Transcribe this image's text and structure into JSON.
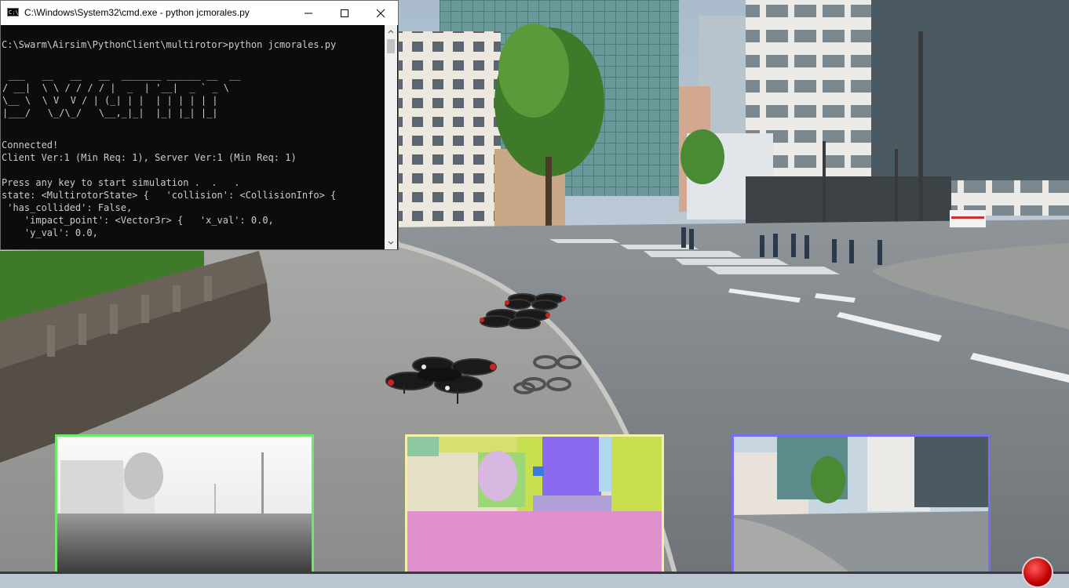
{
  "cmd_window": {
    "title": "C:\\Windows\\System32\\cmd.exe - python  jcmorales.py",
    "icon_label": "C:\\",
    "prompt": "C:\\Swarm\\Airsim\\PythonClient\\multirotor>python jcmorales.py",
    "banner": [
      " ___   __   __   __  _______ ______ __  __ ",
      "/ __|  \\ \\ / / / / |  _  | '__|  _ ` _ \\",
      "\\__ \\  \\ V  V / | (_| | |  | | | | | |",
      "|___/   \\_/\\_/   \\__,_|_|  |_| |_| |_|"
    ],
    "connected": "Connected!",
    "version": "Client Ver:1 (Min Req: 1), Server Ver:1 (Min Req: 1)",
    "press_key": "Press any key to start simulation .  .   .",
    "state_line": "state: <MultirotorState> {   'collision': <CollisionInfo> {",
    "has_collided": " 'has_collided': False,",
    "impact_point": "    'impact_point': <Vector3r> {   'x_val': 0.0,",
    "y_val": "    'y_val': 0.0,",
    "minimize_icon": "minimize-icon",
    "maximize_icon": "maximize-icon",
    "close_icon": "close-icon"
  },
  "subwindows": [
    {
      "name": "depth-view",
      "border_color": "#6ee86a"
    },
    {
      "name": "segmentation-view",
      "border_color": "#f5f0a8"
    },
    {
      "name": "scene-view",
      "border_color": "#7a6ef0"
    }
  ],
  "colors": {
    "console_bg": "#0c0c0c",
    "console_text": "#cccccc",
    "drone_body": "#1a1a1a",
    "drone_accent": "#d02020",
    "record_button": "#d00000"
  }
}
